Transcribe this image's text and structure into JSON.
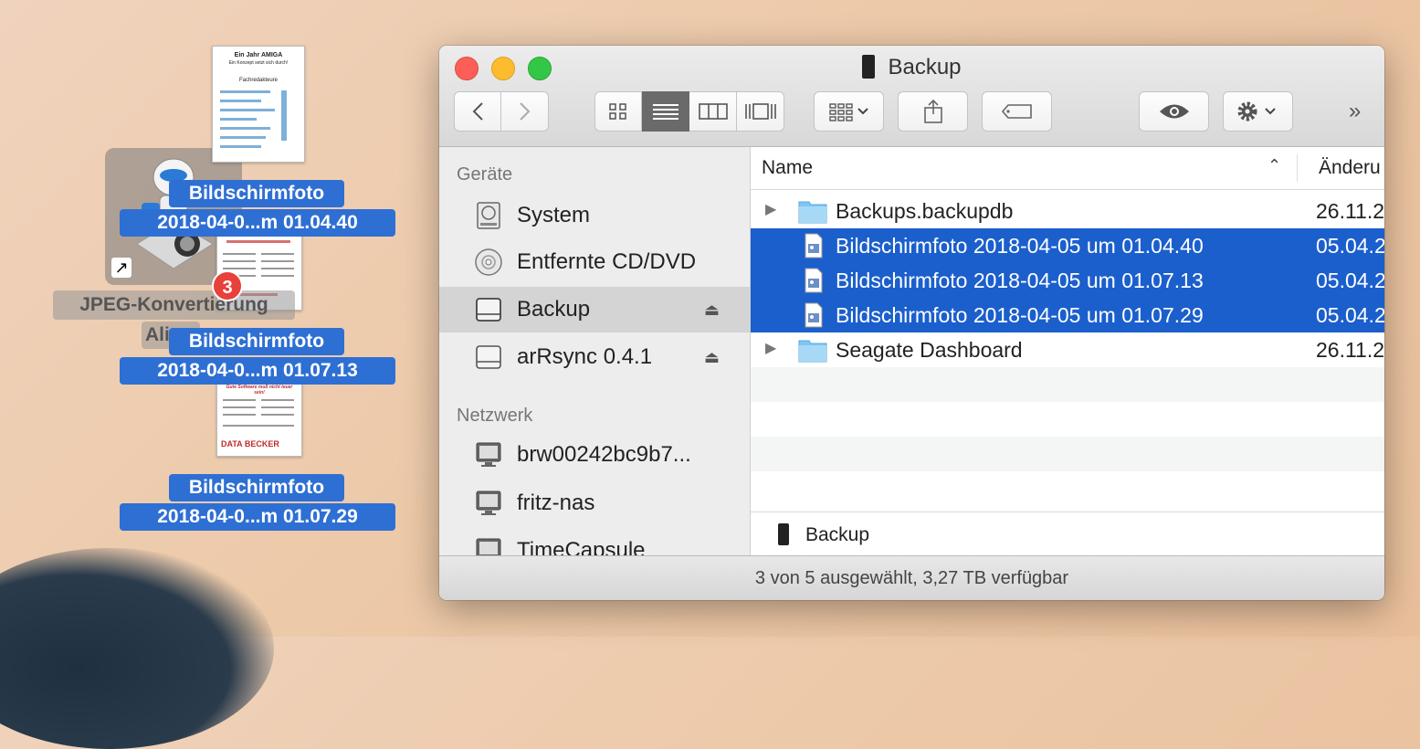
{
  "desktop": {
    "app_label_line1": "JPEG-Konvertierung",
    "app_label_line2": "Ali",
    "badge_count": "3",
    "files": [
      {
        "line1": "Bildschirmfoto",
        "line2": "2018-04-0...m 01.04.40"
      },
      {
        "line1": "Bildschirmfoto",
        "line2": "2018-04-0...m 01.07.13"
      },
      {
        "line1": "Bildschirmfoto",
        "line2": "2018-04-0...m 01.07.29"
      }
    ],
    "thumb1": {
      "title": "Ein Jahr AMIGA",
      "subtitle": "Ein Konzept setzt sich durch!",
      "heading": "Fachredakteure"
    },
    "thumb2": {
      "headline": "Gute Software muß nicht teuer sein!",
      "brand": "DATA BECKER"
    }
  },
  "window": {
    "title": "Backup",
    "colors": {
      "selection": "#1b5fcc",
      "close": "#fc5f57",
      "minimize": "#fdbc2e",
      "maximize": "#33c748"
    }
  },
  "toolbar": {
    "back_icon": "chevron-left-icon",
    "forward_icon": "chevron-right-icon",
    "view_modes": [
      "icon-view",
      "list-view",
      "column-view",
      "coverflow-view"
    ],
    "active_view": "list-view",
    "overflow": "»"
  },
  "sidebar": {
    "devices_header": "Geräte",
    "devices": [
      {
        "label": "System",
        "icon": "harddisk-icon",
        "eject": false
      },
      {
        "label": "Entfernte CD/DVD",
        "icon": "cd-icon",
        "eject": false
      },
      {
        "label": "Backup",
        "icon": "external-disk-icon",
        "eject": true,
        "selected": true
      },
      {
        "label": "arRsync 0.4.1",
        "icon": "external-disk-icon",
        "eject": true
      }
    ],
    "network_header": "Netzwerk",
    "network": [
      {
        "label": "brw00242bc9b7...",
        "icon": "monitor-icon"
      },
      {
        "label": "fritz-nas",
        "icon": "monitor-icon"
      },
      {
        "label": "TimeCapsule",
        "icon": "monitor-icon"
      }
    ]
  },
  "list": {
    "col_name": "Name",
    "col_date": "Änderu",
    "rows": [
      {
        "name": "Backups.backupdb",
        "date": "26.11.2",
        "type": "folder",
        "selected": false
      },
      {
        "name": "Bildschirmfoto 2018-04-05 um 01.04.40",
        "date": "05.04.2",
        "type": "image",
        "selected": true
      },
      {
        "name": "Bildschirmfoto 2018-04-05 um 01.07.13",
        "date": "05.04.2",
        "type": "image",
        "selected": true
      },
      {
        "name": "Bildschirmfoto 2018-04-05 um 01.07.29",
        "date": "05.04.2",
        "type": "image",
        "selected": true
      },
      {
        "name": "Seagate Dashboard",
        "date": "26.11.2",
        "type": "folder",
        "selected": false
      }
    ]
  },
  "pathbar": {
    "label": "Backup"
  },
  "status": {
    "text": "3 von 5 ausgewählt, 3,27 TB verfügbar"
  }
}
